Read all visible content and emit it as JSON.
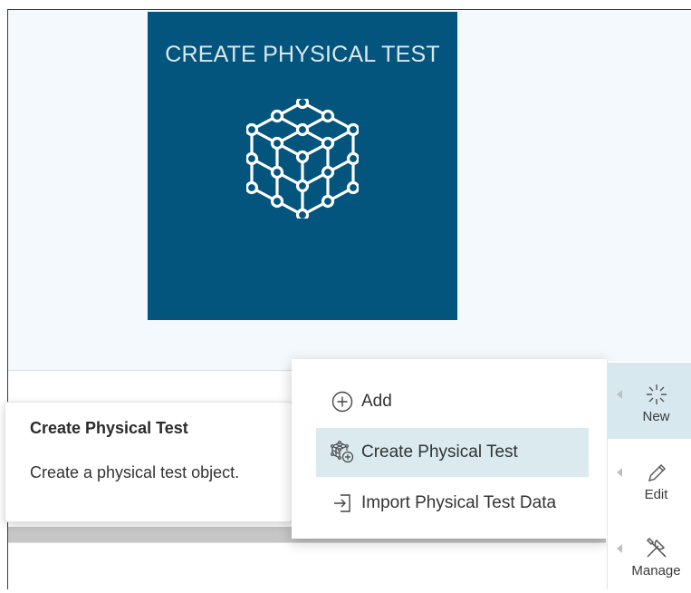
{
  "tile": {
    "title": "CREATE PHYSICAL TEST",
    "icon": "cube-network-icon",
    "background": "#03557d"
  },
  "tooltip": {
    "title": "Create Physical Test",
    "description": "Create a physical test object."
  },
  "menu": {
    "items": [
      {
        "label": "Add",
        "icon": "add-circle-icon",
        "selected": false
      },
      {
        "label": "Create Physical Test",
        "icon": "create-physical-test-icon",
        "selected": true
      },
      {
        "label": "Import Physical Test Data",
        "icon": "import-icon",
        "selected": false
      }
    ]
  },
  "right_panel": {
    "buttons": [
      {
        "label": "New",
        "icon": "sparkle-icon",
        "active": true
      },
      {
        "label": "Edit",
        "icon": "pencil-icon",
        "active": false
      },
      {
        "label": "Manage",
        "icon": "tools-icon",
        "active": false
      }
    ]
  },
  "colors": {
    "selection": "#daeaef",
    "panel_bg": "#f3f9fc"
  }
}
